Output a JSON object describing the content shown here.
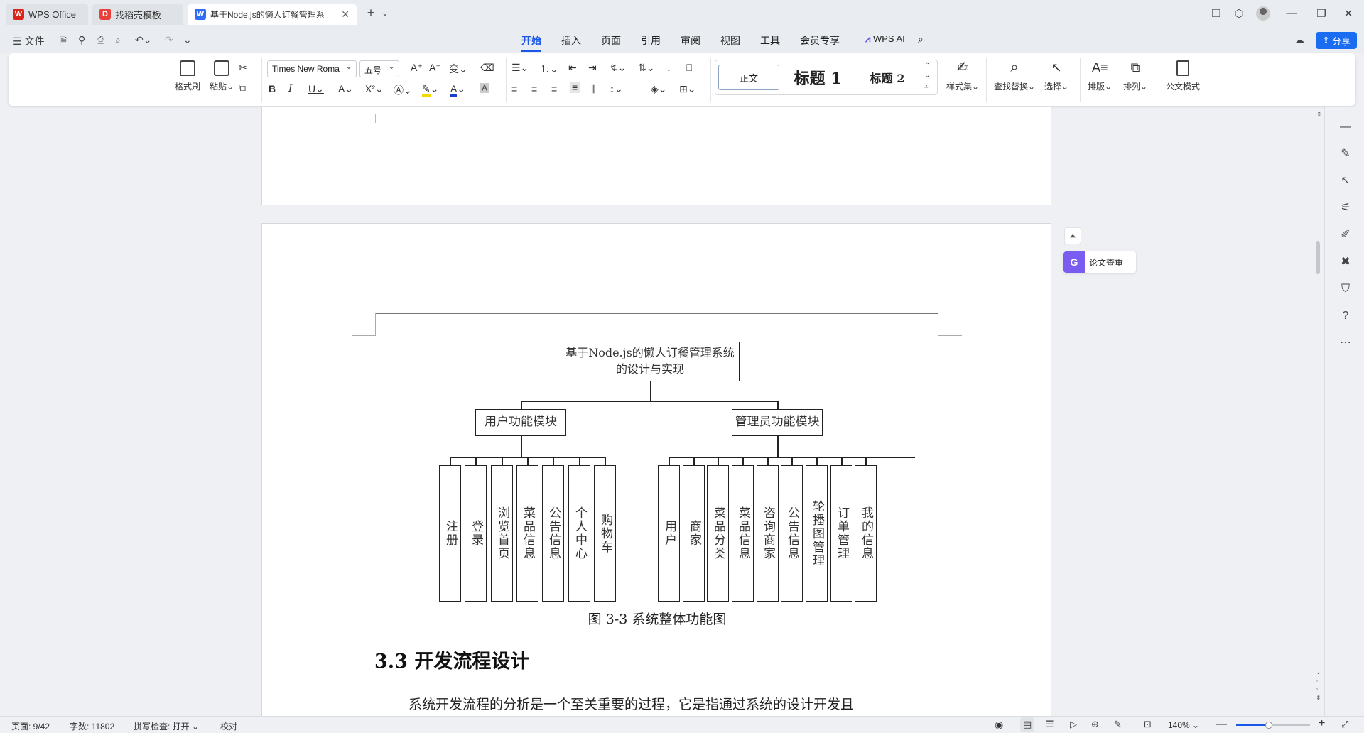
{
  "app": {
    "tabs": [
      {
        "label": "WPS Office",
        "icon": "wps-logo-icon"
      },
      {
        "label": "找稻壳模板",
        "icon": "docer-icon"
      },
      {
        "label": "基于Node.js的懒人订餐管理系",
        "icon": "word-doc-icon"
      }
    ],
    "new_tab": "+"
  },
  "menu": {
    "file": "文件",
    "tabs": [
      "开始",
      "插入",
      "页面",
      "引用",
      "审阅",
      "视图",
      "工具",
      "会员专享"
    ],
    "active_tab": "开始",
    "wps_ai": "WPS AI",
    "share": "分享"
  },
  "ribbon": {
    "format_painter": "格式刷",
    "paste": "粘贴",
    "font_name": "Times New Roma",
    "font_size": "五号",
    "styles": {
      "normal": "正文",
      "h1": "标题  1",
      "h2": "标题  2"
    },
    "style_set": "样式集",
    "find_replace": "查找替换",
    "select": "选择",
    "layout": "排版",
    "arrange": "排列",
    "official_mode": "公文模式",
    "accent_color": "#1a56e8",
    "font_color_bar": "#1a3fd0",
    "highlight_bar": "#f5d800"
  },
  "sidepanel": {
    "essay_check": "论文查重",
    "essay_check_glyph": "G"
  },
  "document": {
    "diagram": {
      "root": "基于Node.js的懒人订餐管理系统的设计与实现",
      "user_module": "用户功能模块",
      "admin_module": "管理员功能模块",
      "user_items": [
        "注册",
        "登录",
        "浏览首页",
        "菜品信息",
        "公告信息",
        "个人中心",
        "购物车"
      ],
      "admin_items": [
        "用户",
        "商家",
        "菜品分类",
        "菜品信息",
        "咨询商家",
        "公告信息",
        "轮播图管理",
        "订单管理",
        "我的信息"
      ]
    },
    "caption": "图 3-3  系统整体功能图",
    "section_heading": "3.3 开发流程设计",
    "body_text": "系统开发流程的分析是一个至关重要的过程，它是指通过系统的设计开发且"
  },
  "status": {
    "page": "页面: 9/42",
    "words": "字数: 11802",
    "spell": "拼写检查: 打开",
    "proofread": "校对",
    "zoom": "140%"
  }
}
